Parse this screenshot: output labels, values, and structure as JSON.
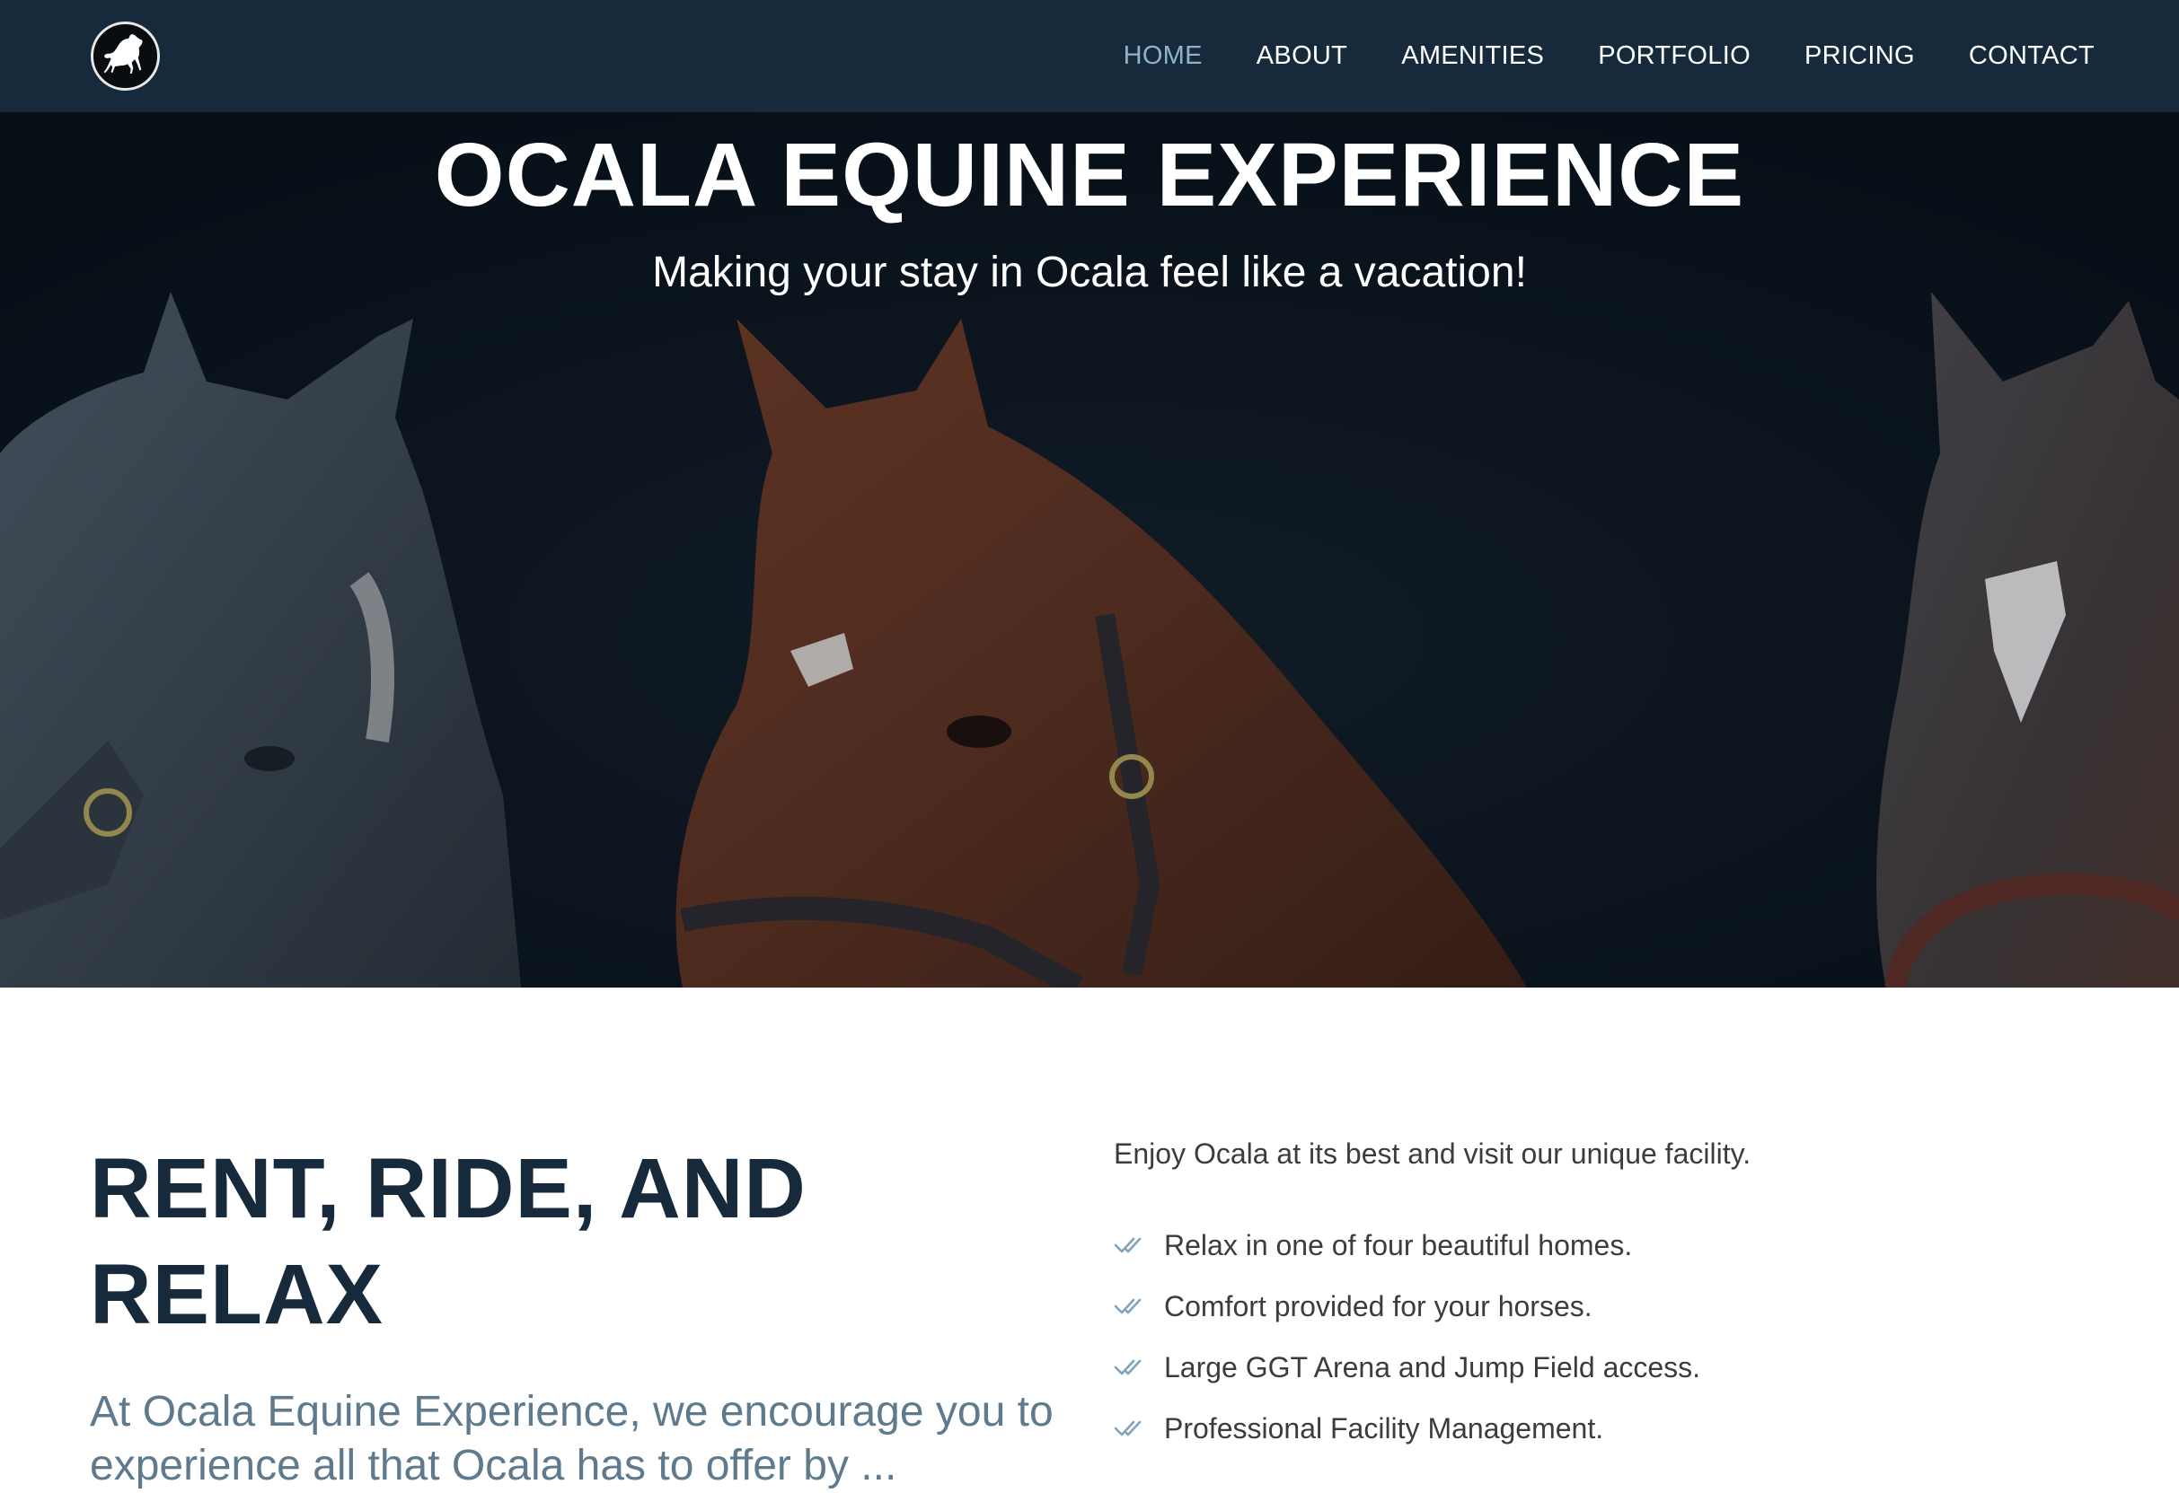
{
  "nav": {
    "logo_icon": "horse-logo-icon",
    "items": [
      {
        "label": "HOME",
        "active": true
      },
      {
        "label": "ABOUT",
        "active": false
      },
      {
        "label": "AMENITIES",
        "active": false
      },
      {
        "label": "PORTFOLIO",
        "active": false
      },
      {
        "label": "PRICING",
        "active": false
      },
      {
        "label": "CONTACT",
        "active": false
      }
    ]
  },
  "hero": {
    "title": "OCALA EQUINE EXPERIENCE",
    "subtitle": "Making your stay in Ocala feel like a vacation!",
    "image_icon": "horses-hero-image"
  },
  "intro": {
    "heading": "RENT, RIDE, AND RELAX",
    "lead": "At Ocala Equine Experience, we encourage you to experience all that Ocala has to offer by ...",
    "right_intro": "Enjoy Ocala at its best and visit our unique facility.",
    "features": [
      "Relax in one of four beautiful homes.",
      "Comfort provided for your horses.",
      "Large GGT Arena and Jump Field access.",
      "Professional Facility Management."
    ],
    "feature_icon": "double-check-icon"
  },
  "colors": {
    "nav_bg": "#162a3b",
    "nav_active": "#8fb4c8",
    "heading": "#162a3b",
    "lead": "#5e7a8c",
    "body_text": "#3a3d40",
    "check": "#7fa3b8",
    "hero_bg": "#0b1520"
  }
}
